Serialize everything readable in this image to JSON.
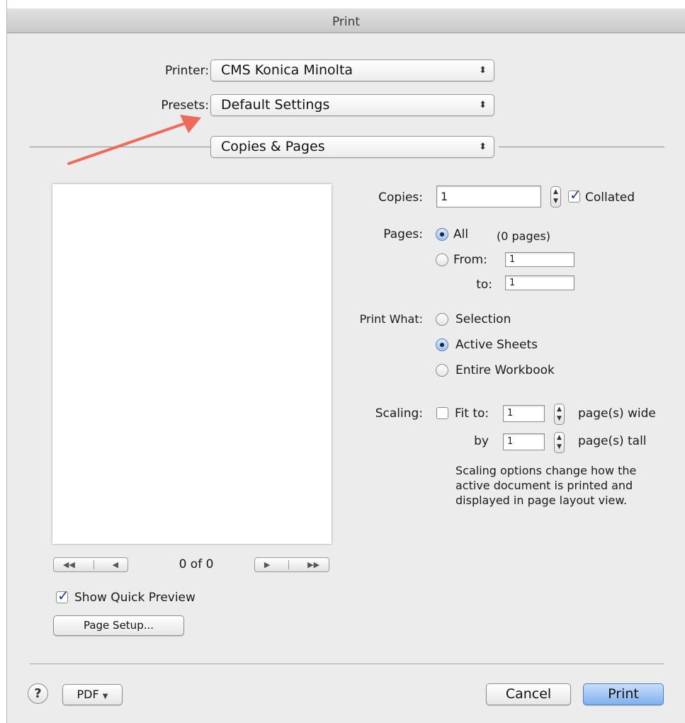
{
  "window": {
    "title": "Print"
  },
  "printer": {
    "label": "Printer:",
    "value": "CMS Konica Minolta"
  },
  "presets": {
    "label": "Presets:",
    "value": "Default Settings"
  },
  "section_popup": {
    "value": "Copies & Pages"
  },
  "preview": {
    "page_count": "0 of 0",
    "show_quick_preview": {
      "label": "Show Quick Preview",
      "checked": true
    },
    "page_setup_label": "Page Setup..."
  },
  "copies": {
    "label": "Copies:",
    "value": "1",
    "collated_label": "Collated",
    "collated": true
  },
  "pages": {
    "label": "Pages:",
    "all_label": "All",
    "count_note": "(0 pages)",
    "from_label": "From:",
    "from_value": "1",
    "to_label": "to:",
    "to_value": "1",
    "selected": "All"
  },
  "print_what": {
    "label": "Print What:",
    "options": [
      "Selection",
      "Active Sheets",
      "Entire Workbook"
    ],
    "selected": "Active Sheets"
  },
  "scaling": {
    "label": "Scaling:",
    "fit_to_label": "Fit to:",
    "fit_to_checked": false,
    "wide_value": "1",
    "wide_label": "page(s) wide",
    "by_label": "by",
    "tall_value": "1",
    "tall_label": "page(s) tall",
    "info": "Scaling options change how the active document is printed and displayed in page layout view."
  },
  "footer": {
    "help": "?",
    "pdf_label": "PDF",
    "cancel_label": "Cancel",
    "print_label": "Print"
  },
  "annotation": {
    "arrow_color": "#ee6b5b"
  }
}
